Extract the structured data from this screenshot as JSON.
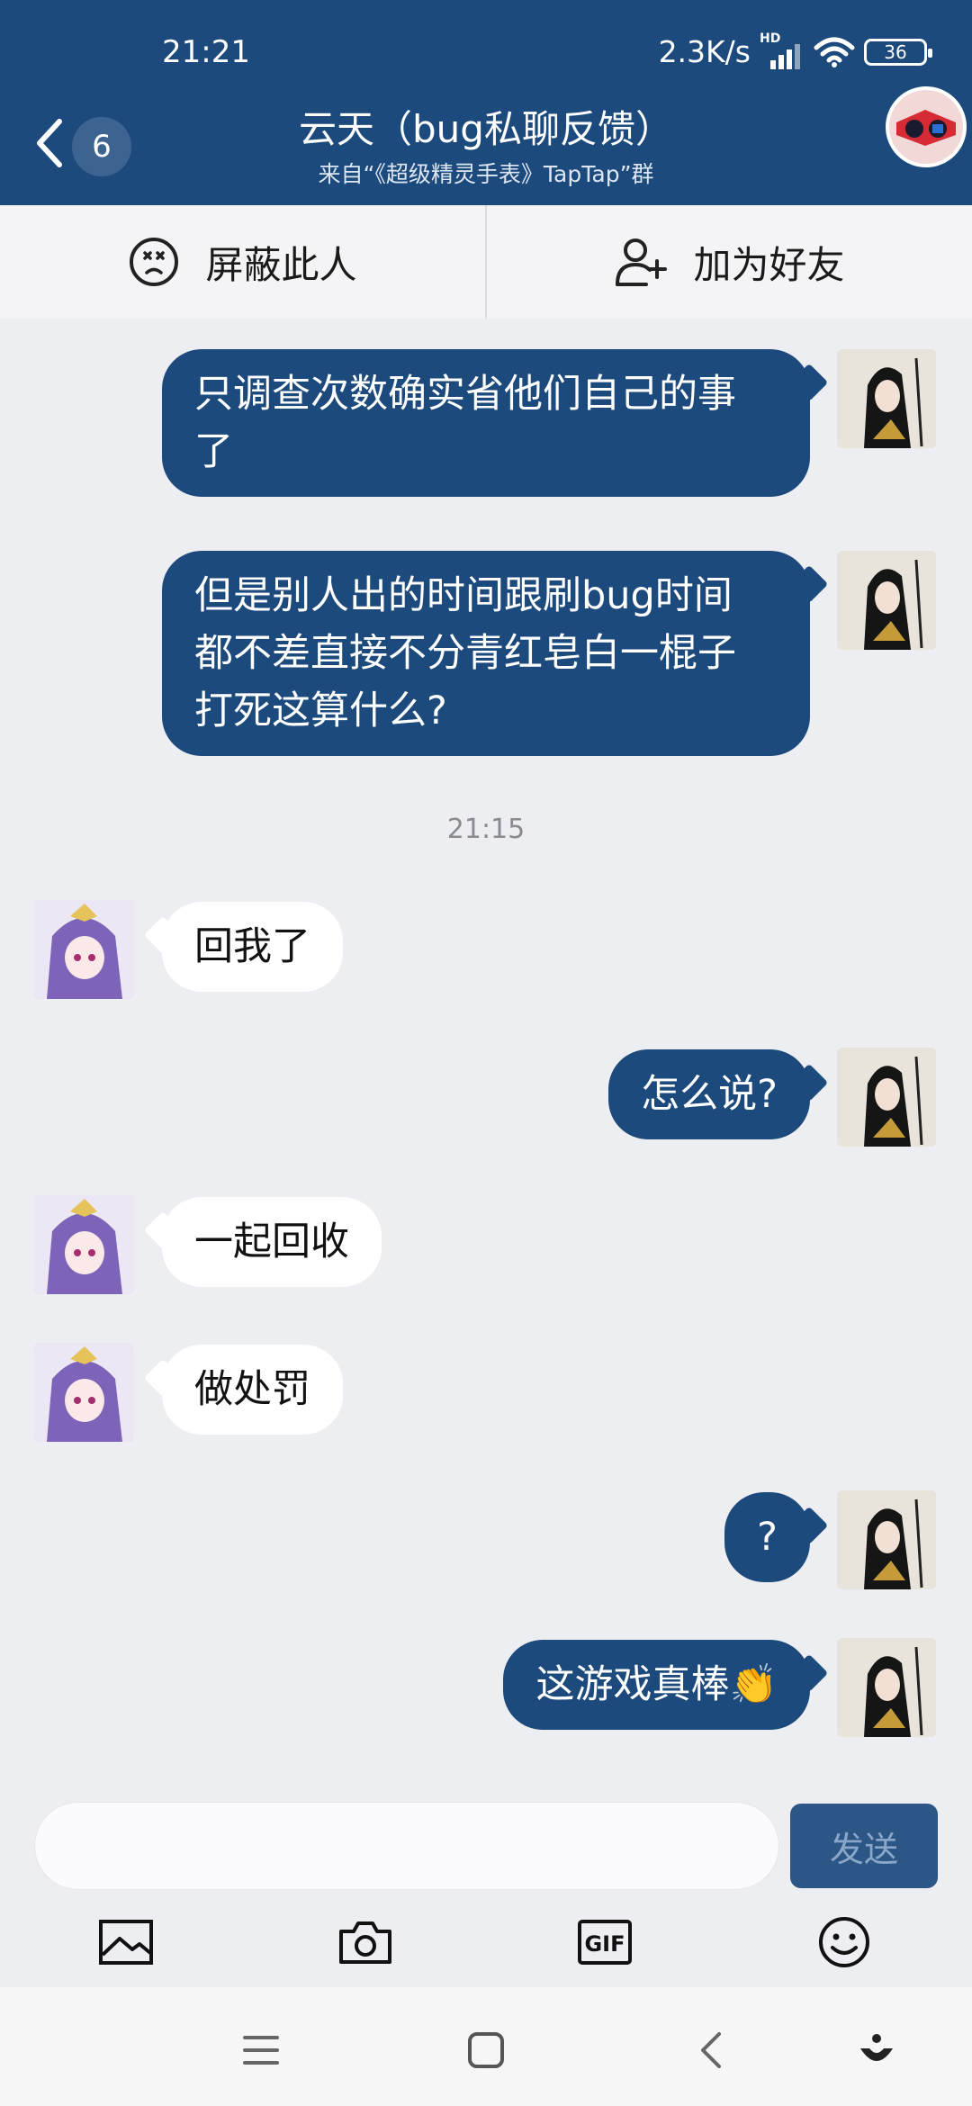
{
  "status_bar": {
    "time": "21:21",
    "net_speed": "2.3K/s",
    "hd_label": "HD",
    "battery": "36"
  },
  "header": {
    "unread_count": "6",
    "title": "云天（bug私聊反馈）",
    "subtitle": "来自“《超级精灵手表》TapTap”群"
  },
  "actions": {
    "block_label": "屏蔽此人",
    "add_friend_label": "加为好友"
  },
  "messages": [
    {
      "side": "out",
      "text": "只调查次数确实省他们自己的事了"
    },
    {
      "side": "out",
      "text": "但是别人出的时间跟刷bug时间都不差直接不分青红皂白一棍子打死这算什么?"
    },
    {
      "side": "in",
      "text": "回我了"
    },
    {
      "side": "out",
      "text": "怎么说?"
    },
    {
      "side": "in",
      "text": "一起回收"
    },
    {
      "side": "in",
      "text": "做处罚"
    },
    {
      "side": "out",
      "text": "?"
    },
    {
      "side": "out",
      "text": "这游戏真棒👏"
    }
  ],
  "message_lines": {
    "m0": [
      "只调查次数确实省他们自己的事",
      "了"
    ],
    "m1": [
      "但是别人出的时间跟刷bug时间",
      "都不差直接不分青红皂白一棍子",
      "打死这算什么?"
    ]
  },
  "time_divider": "21:15",
  "composer": {
    "input_placeholder": "",
    "send_label": "发送"
  },
  "toolbar": {
    "gif_label": "GIF"
  },
  "colors": {
    "brand": "#1c4a7c",
    "background": "#edeef2",
    "incoming_bubble": "#ffffff",
    "outgoing_bubble": "#1c4a7c"
  },
  "icons": [
    "back-chevron-icon",
    "wifi-icon",
    "signal-icon",
    "battery-icon",
    "block-face-icon",
    "add-user-icon",
    "image-icon",
    "camera-icon",
    "gif-icon",
    "emoji-icon",
    "menu-icon",
    "home-icon",
    "back-icon",
    "assist-icon"
  ]
}
